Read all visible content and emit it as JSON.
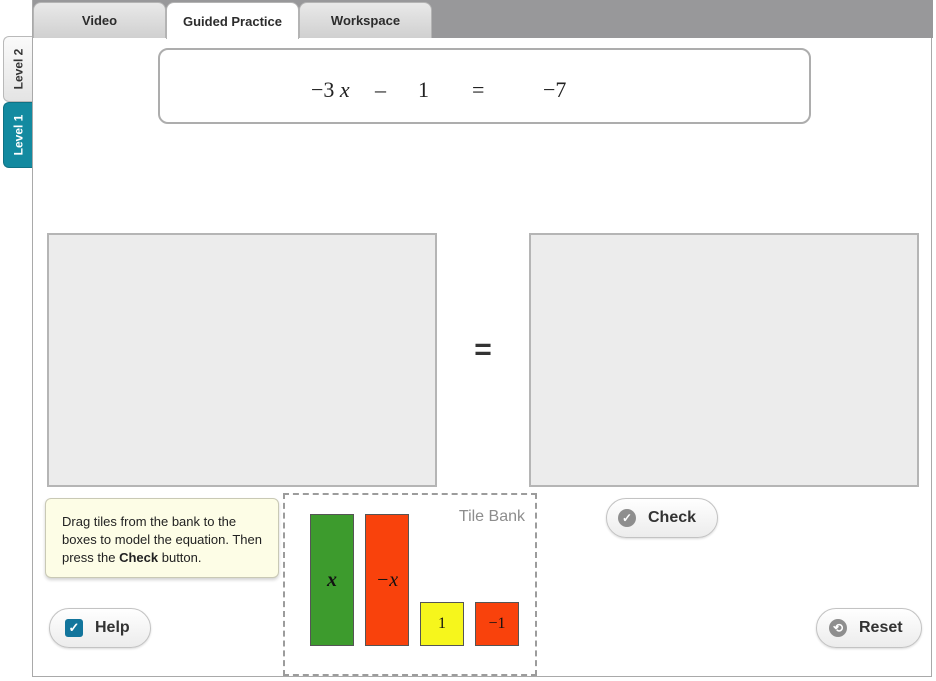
{
  "levels": [
    {
      "label": "Level 2",
      "active": false
    },
    {
      "label": "Level 1",
      "active": true
    }
  ],
  "tabs": [
    {
      "label": "Video"
    },
    {
      "label": "Guided Practice",
      "selected": true
    },
    {
      "label": "Workspace"
    }
  ],
  "equation": {
    "lhs_coefficient": "−3",
    "lhs_variable": "x",
    "operator": "–",
    "lhs_constant": "1",
    "equals": "=",
    "rhs": "−7"
  },
  "model": {
    "equals": "="
  },
  "instructions": {
    "text_before": "Drag tiles from the bank to the boxes to model the equation. Then press the ",
    "bold": "Check",
    "text_after": " button."
  },
  "tile_bank": {
    "label": "Tile Bank",
    "tiles": [
      {
        "label": "x",
        "color": "#3d9b2d"
      },
      {
        "label": "−x",
        "color": "#f9420c"
      },
      {
        "label": "1",
        "color": "#f6f61c"
      },
      {
        "label": "−1",
        "color": "#f9420c"
      }
    ]
  },
  "buttons": {
    "check": {
      "label": "Check",
      "icon": "check-circle-icon"
    },
    "help": {
      "label": "Help",
      "icon": "checkbox-checked-icon",
      "checked": true
    },
    "reset": {
      "label": "Reset",
      "icon": "reset-circle-icon"
    }
  },
  "colors": {
    "accent": "#138aa0",
    "tab_bar": "#98989a",
    "note_bg": "#fdfde6"
  }
}
